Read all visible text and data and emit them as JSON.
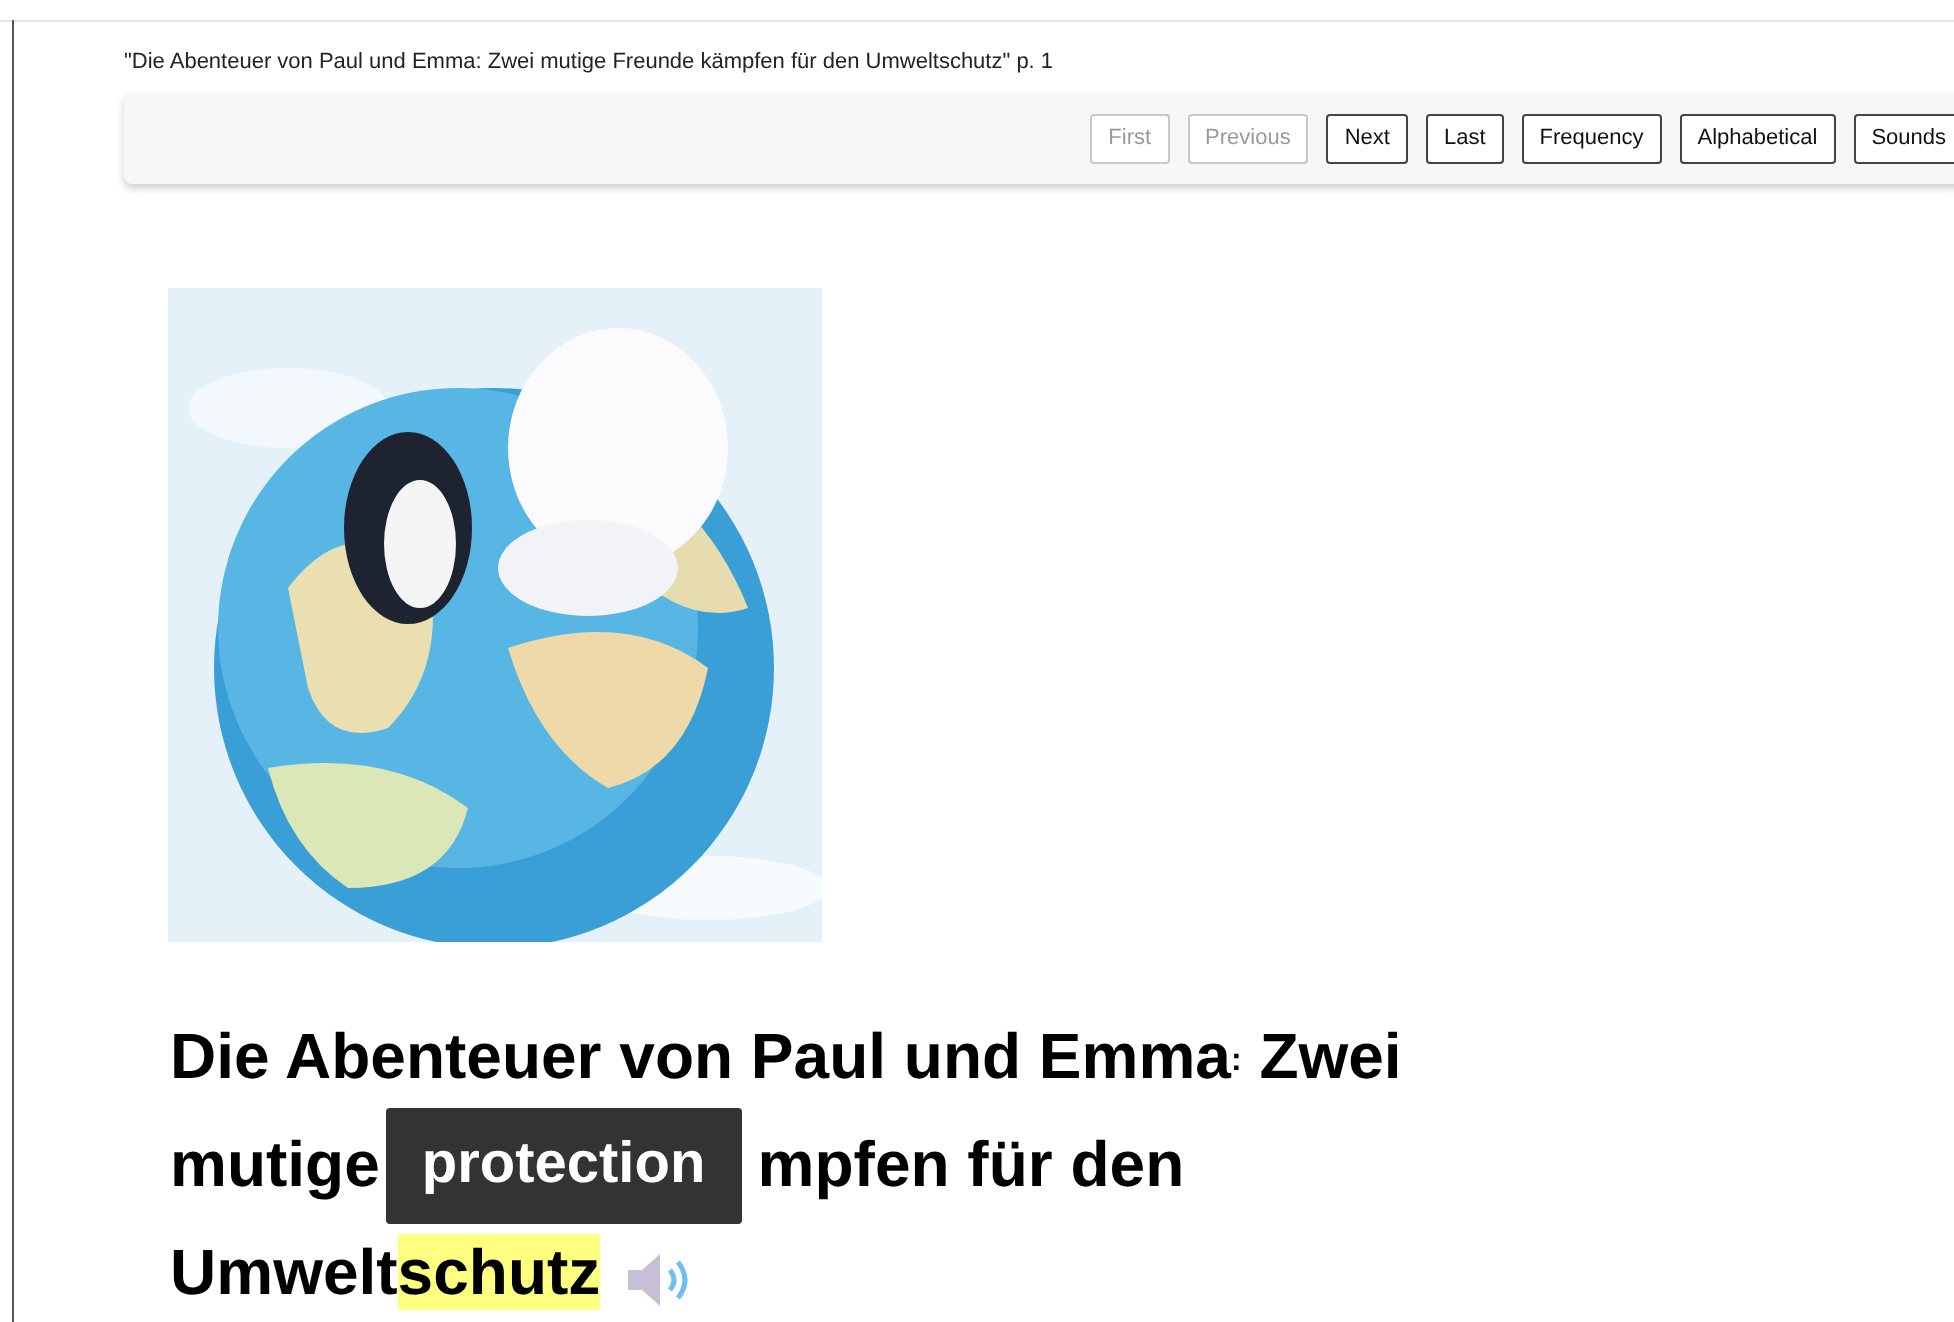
{
  "page_title": "\"Die Abenteuer von Paul und Emma: Zwei mutige Freunde kämpfen für den Umweltschutz\" p. 1",
  "nav_buttons": [
    {
      "label": "First",
      "disabled": true
    },
    {
      "label": "Previous",
      "disabled": true
    },
    {
      "label": "Next",
      "disabled": false
    },
    {
      "label": "Last",
      "disabled": false
    },
    {
      "label": "Frequency",
      "disabled": false
    },
    {
      "label": "Alphabetical",
      "disabled": false
    },
    {
      "label": "Sounds",
      "disabled": false
    }
  ],
  "heading_lines": [
    [
      {
        "kind": "text",
        "text": "Die Abenteuer von Paul und Emma"
      },
      {
        "kind": "small",
        "text": ":"
      },
      {
        "kind": "text",
        "text": " Zwei"
      }
    ],
    [
      {
        "kind": "text",
        "text": "mutige "
      },
      {
        "kind": "covered"
      },
      {
        "kind": "text",
        "text": "mpfen für den"
      }
    ],
    [
      {
        "kind": "text",
        "text": "Umwelt"
      },
      {
        "kind": "highlight",
        "text": "schutz"
      },
      {
        "kind": "speaker"
      }
    ]
  ],
  "tooltip": {
    "text": "protection"
  }
}
